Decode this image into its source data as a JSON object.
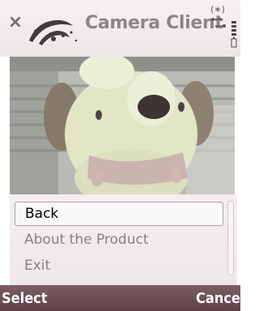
{
  "header": {
    "title": "Camera Client",
    "close_icon": "close-icon",
    "status_icons": [
      "bluetooth-icon",
      "network-icon",
      "battery-icon"
    ],
    "bluetooth_glyph": "(∗)"
  },
  "viewfinder": {
    "subject": "plush-toy-camera-feed"
  },
  "menu": {
    "items": [
      {
        "label": "Back",
        "selected": true
      },
      {
        "label": "About the Product",
        "selected": false
      },
      {
        "label": "Exit",
        "selected": false
      }
    ]
  },
  "softkeys": {
    "left": "Select",
    "right": "Cancel"
  },
  "colors": {
    "softkey_bar": "#6e4f55",
    "title_text": "#8a8686",
    "menu_bg": "#f2ecee"
  }
}
